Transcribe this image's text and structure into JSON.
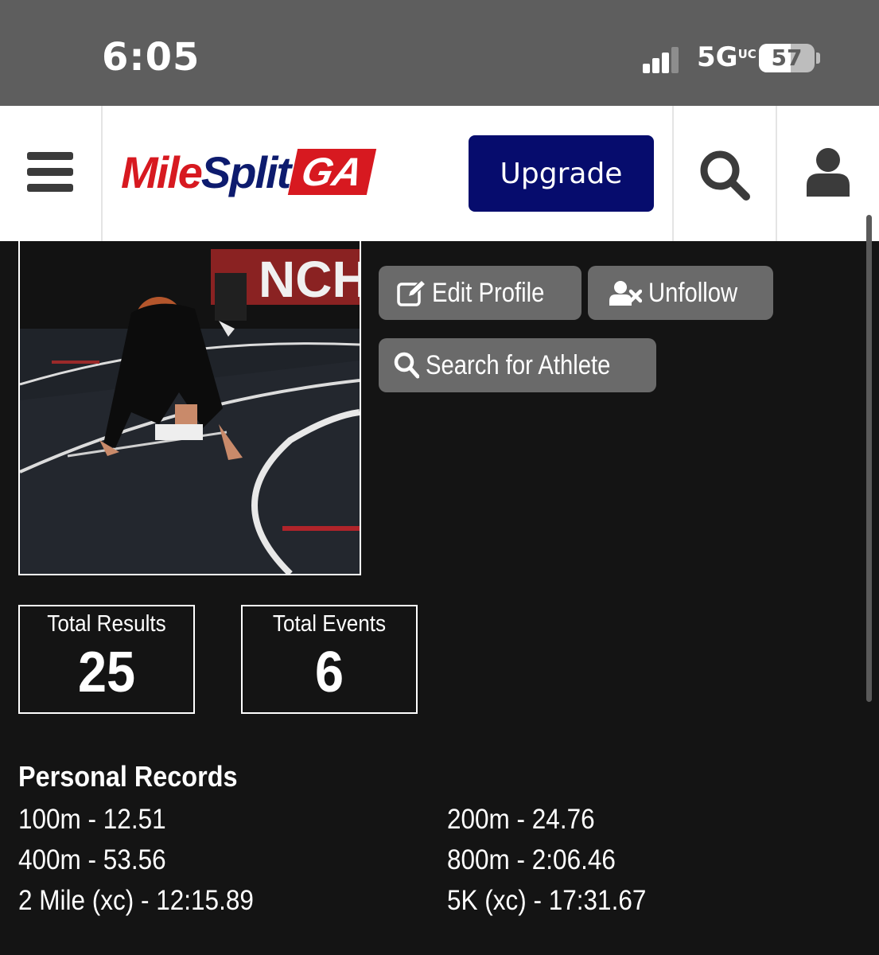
{
  "status_bar": {
    "time": "6:05",
    "network": "5G",
    "network_suffix": "UC",
    "battery": "57"
  },
  "header": {
    "logo_text_1": "Mile",
    "logo_text_2": "Split",
    "logo_badge": "GA",
    "upgrade_label": "Upgrade",
    "icons": [
      "menu-icon",
      "search-icon",
      "user-icon"
    ],
    "brand_colors": {
      "red": "#d71920",
      "navy": "#060c6d"
    }
  },
  "actions": {
    "edit_profile": "Edit Profile",
    "unfollow": "Unfollow",
    "search_athlete": "Search for Athlete"
  },
  "stats": [
    {
      "label": "Total Results",
      "value": "25"
    },
    {
      "label": "Total Events",
      "value": "6"
    }
  ],
  "personal_records": {
    "title": "Personal Records",
    "items": [
      "100m - 12.51",
      "200m - 24.76",
      "400m - 53.56",
      "800m - 2:06.46",
      "2 Mile (xc) - 12:15.89",
      "5K (xc) - 17:31.67"
    ]
  }
}
